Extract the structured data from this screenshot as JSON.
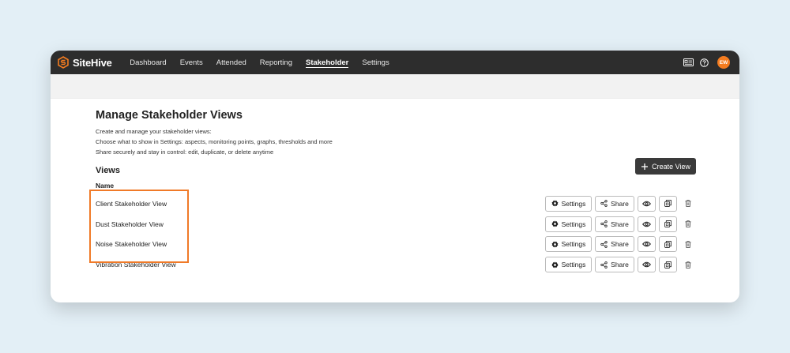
{
  "app": {
    "logo": "SiteHive"
  },
  "nav": [
    {
      "label": "Dashboard",
      "active": false
    },
    {
      "label": "Events",
      "active": false
    },
    {
      "label": "Attended",
      "active": false
    },
    {
      "label": "Reporting",
      "active": false
    },
    {
      "label": "Stakeholder",
      "active": true
    },
    {
      "label": "Settings",
      "active": false
    }
  ],
  "user": {
    "initials": "EW"
  },
  "page": {
    "title": "Manage Stakeholder Views",
    "description": [
      "Create and manage your stakeholder views:",
      "Choose what to show in Settings: aspects, monitoring points, graphs, thresholds and more",
      "Share securely and stay in control: edit, duplicate, or delete anytime"
    ],
    "views_heading": "Views",
    "create_label": "Create View",
    "name_header": "Name"
  },
  "views": [
    {
      "name": "Client Stakeholder View"
    },
    {
      "name": "Dust Stakeholder View"
    },
    {
      "name": "Noise Stakeholder View"
    },
    {
      "name": "Vibration Stakeholder View"
    }
  ],
  "row_actions": {
    "settings_label": "Settings",
    "share_label": "Share"
  },
  "colors": {
    "accent": "#f47c20",
    "topbar": "#2d2d2d",
    "highlight": "#f07a28",
    "primary_button": "#3a3a3a"
  }
}
